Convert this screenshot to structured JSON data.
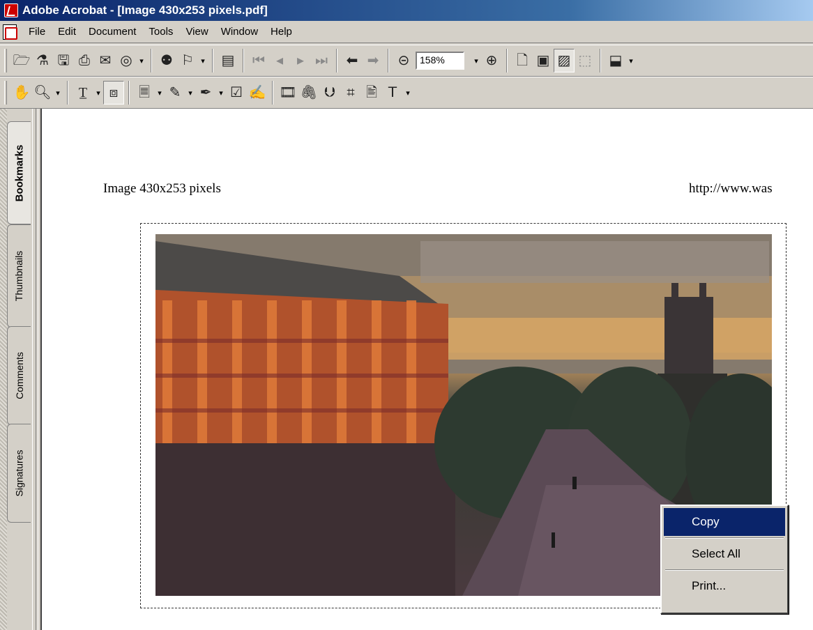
{
  "window": {
    "title": "Adobe Acrobat - [Image 430x253 pixels.pdf]"
  },
  "menu": [
    "File",
    "Edit",
    "Document",
    "Tools",
    "View",
    "Window",
    "Help"
  ],
  "toolbar": {
    "zoom": "158%"
  },
  "nav_tabs": [
    "Bookmarks",
    "Thumbnails",
    "Comments",
    "Signatures"
  ],
  "document": {
    "header_left": "Image 430x253 pixels",
    "header_right": "http://www.was"
  },
  "context_menu": {
    "items": [
      "Copy",
      "Select All",
      "Print..."
    ]
  },
  "icons": {
    "open": "open-folder-icon",
    "print": "printer-icon",
    "search": "binoculars-icon",
    "hand": "hand-tool-icon",
    "zoom_in": "zoom-in-icon"
  },
  "colors": {
    "title_bar": "#0a246a",
    "menu_highlight": "#0a246a",
    "chrome": "#d4d0c8"
  }
}
